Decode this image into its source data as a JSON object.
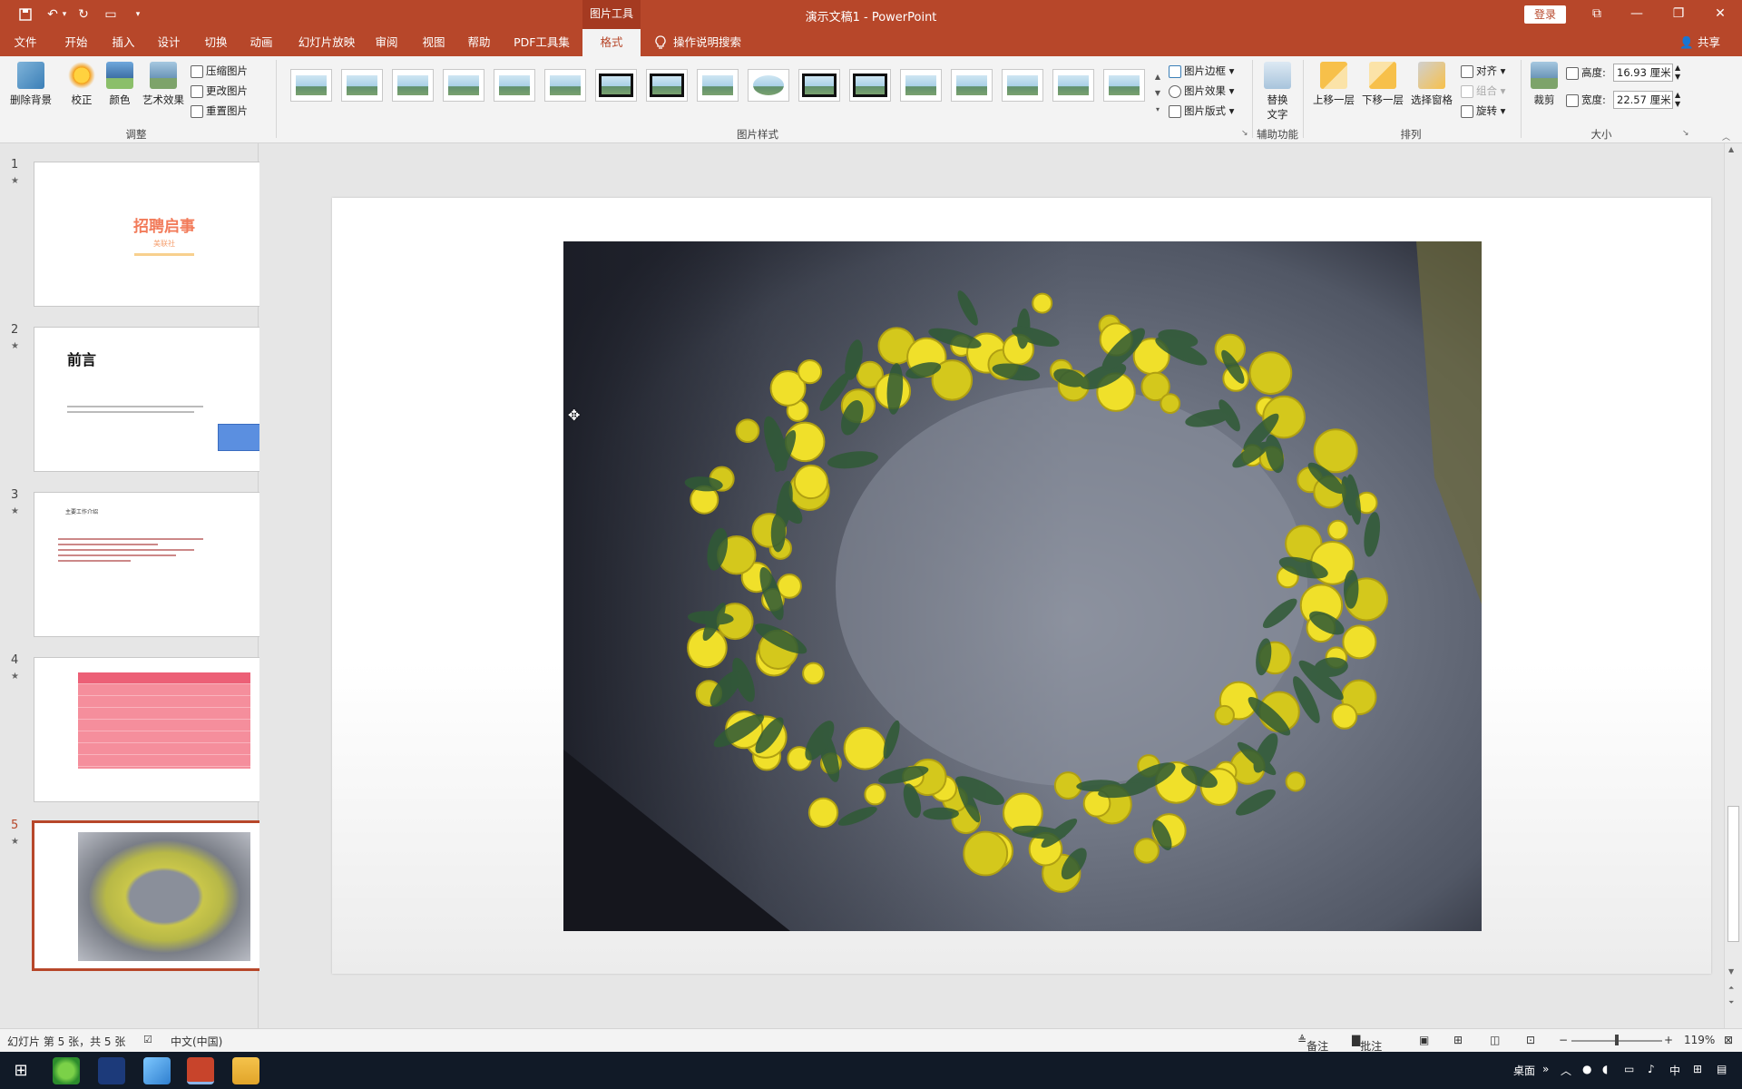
{
  "app": {
    "context_tab_label": "图片工具",
    "window_title": "演示文稿1 - PowerPoint",
    "login_label": "登录",
    "share_label": "共享",
    "accent_color": "#b7472a"
  },
  "menu": {
    "tabs": [
      "文件",
      "开始",
      "插入",
      "设计",
      "切换",
      "动画",
      "幻灯片放映",
      "审阅",
      "视图",
      "帮助",
      "PDF工具集",
      "格式"
    ],
    "active_tab": "格式",
    "tell_me": "操作说明搜索"
  },
  "ribbon": {
    "adjust": {
      "remove_bg": "删除背景",
      "corrections": "校正",
      "color": "颜色",
      "artistic": "艺术效果",
      "compress": "压缩图片",
      "change": "更改图片",
      "reset": "重置图片",
      "group_label": "调整"
    },
    "styles": {
      "group_label": "图片样式",
      "border": "图片边框",
      "effects": "图片效果",
      "layout": "图片版式"
    },
    "accessibility": {
      "alt_text_line1": "替换",
      "alt_text_line2": "文字",
      "group_label": "辅助功能"
    },
    "arrange": {
      "bring_forward": "上移一层",
      "send_backward": "下移一层",
      "selection_pane": "选择窗格",
      "align": "对齐",
      "group": "组合",
      "rotate": "旋转",
      "group_label": "排列"
    },
    "size": {
      "crop": "裁剪",
      "height_label": "高度:",
      "height_value": "16.93 厘米",
      "width_label": "宽度:",
      "width_value": "22.57 厘米",
      "group_label": "大小"
    }
  },
  "slides": [
    {
      "number": "1",
      "title": "招聘启事",
      "subtitle": "美联社"
    },
    {
      "number": "2",
      "title": "前言"
    },
    {
      "number": "3",
      "title": "主要工作介绍"
    },
    {
      "number": "4"
    },
    {
      "number": "5"
    }
  ],
  "status": {
    "slide_info": "幻灯片 第 5 张，共 5 张",
    "language": "中文(中国)",
    "notes": "备注",
    "comments": "批注",
    "zoom": "119%"
  },
  "taskbar": {
    "desktop_label": "桌面",
    "ime_label": "中"
  }
}
